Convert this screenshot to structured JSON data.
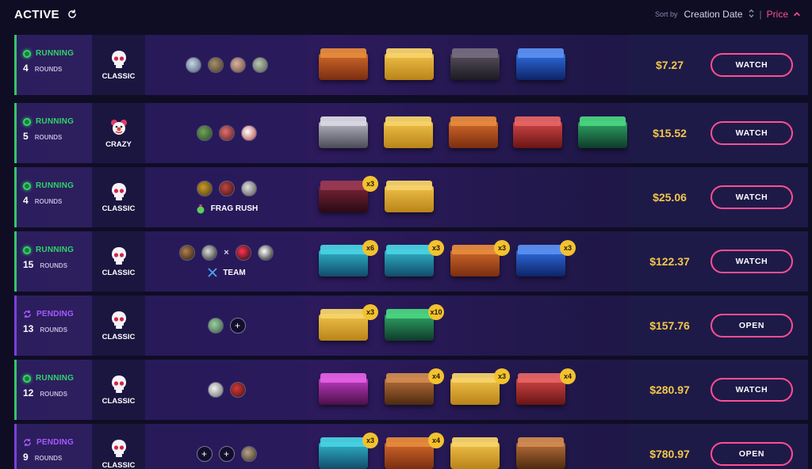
{
  "header": {
    "title": "ACTIVE",
    "sort_by_label": "Sort by",
    "sort_options": [
      "Creation Date",
      "Price"
    ],
    "separator": "|"
  },
  "icons": {
    "refresh": "refresh-icon",
    "sort_toggle": "sort-toggle-icon",
    "chevron": "chevron-up-icon",
    "skull": "skull-icon",
    "clown": "clown-icon",
    "frag_rush": "grenade-icon",
    "team": "crossed-swords-icon",
    "pending": "pending-sync-icon"
  },
  "colors": {
    "running": "#2fd36a",
    "pending": "#a35cff",
    "price": "#f2c74a",
    "accent": "#ff4f93"
  },
  "rows": [
    {
      "status": "RUNNING",
      "rounds": "4",
      "rounds_label": "ROUNDS",
      "mode": "CLASSIC",
      "price": "$7.27",
      "action": "WATCH"
    },
    {
      "status": "RUNNING",
      "rounds": "5",
      "rounds_label": "ROUNDS",
      "mode": "CRAZY",
      "price": "$15.52",
      "action": "WATCH"
    },
    {
      "status": "RUNNING",
      "rounds": "4",
      "rounds_label": "ROUNDS",
      "mode": "CLASSIC",
      "subtitle": "FRAG RUSH",
      "price": "$25.06",
      "action": "WATCH",
      "badges": [
        "x3"
      ]
    },
    {
      "status": "RUNNING",
      "rounds": "15",
      "rounds_label": "ROUNDS",
      "mode": "CLASSIC",
      "subtitle": "TEAM",
      "versus": "×",
      "price": "$122.37",
      "action": "WATCH",
      "badges": [
        "x6",
        "x3",
        "x3",
        "x3"
      ]
    },
    {
      "status": "PENDING",
      "rounds": "13",
      "rounds_label": "ROUNDS",
      "mode": "CLASSIC",
      "join": "+",
      "price": "$157.76",
      "action": "OPEN",
      "badges": [
        "x3",
        "x10"
      ]
    },
    {
      "status": "RUNNING",
      "rounds": "12",
      "rounds_label": "ROUNDS",
      "mode": "CLASSIC",
      "price": "$280.97",
      "action": "WATCH",
      "badges": [
        "x4",
        "x3",
        "x4"
      ]
    },
    {
      "status": "PENDING",
      "rounds": "9",
      "rounds_label": "ROUNDS",
      "mode": "CLASSIC",
      "join": "+",
      "price": "$780.97",
      "action": "OPEN",
      "badges": [
        "x3",
        "x4"
      ]
    }
  ]
}
